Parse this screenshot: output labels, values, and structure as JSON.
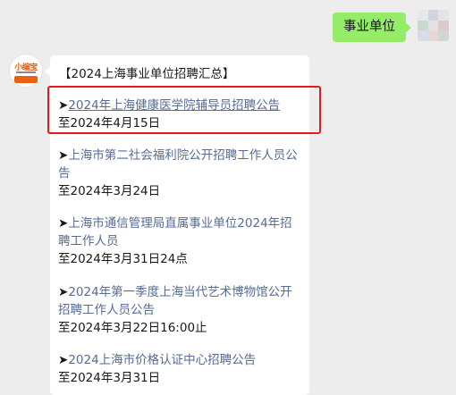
{
  "outgoing": {
    "text": "事业单位"
  },
  "bot": {
    "avatar_label": "小编宝"
  },
  "message": {
    "title": "【2024上海事业单位招聘汇总】",
    "arrow": "➤",
    "items": [
      {
        "link": "2024年上海健康医学院辅导员招聘公告",
        "date": "至2024年4月15日"
      },
      {
        "link": "上海市第二社会福利院公开招聘工作人员公告",
        "date": "至2024年3月24日"
      },
      {
        "link": "上海市通信管理局直属事业单位2024年招聘工作人员",
        "date": "至2024年3月31日24点"
      },
      {
        "link": "2024年第一季度上海当代艺术博物馆公开招聘工作人员公告",
        "date": "至2024年3月22日16:00止"
      },
      {
        "link": "2024上海市价格认证中心招聘公告",
        "date": "至2024年3月31日"
      }
    ]
  },
  "colors": {
    "outgoing_bubble": "#95ec69",
    "link": "#576b95",
    "highlight": "#e21c1c",
    "background": "#ededed"
  }
}
